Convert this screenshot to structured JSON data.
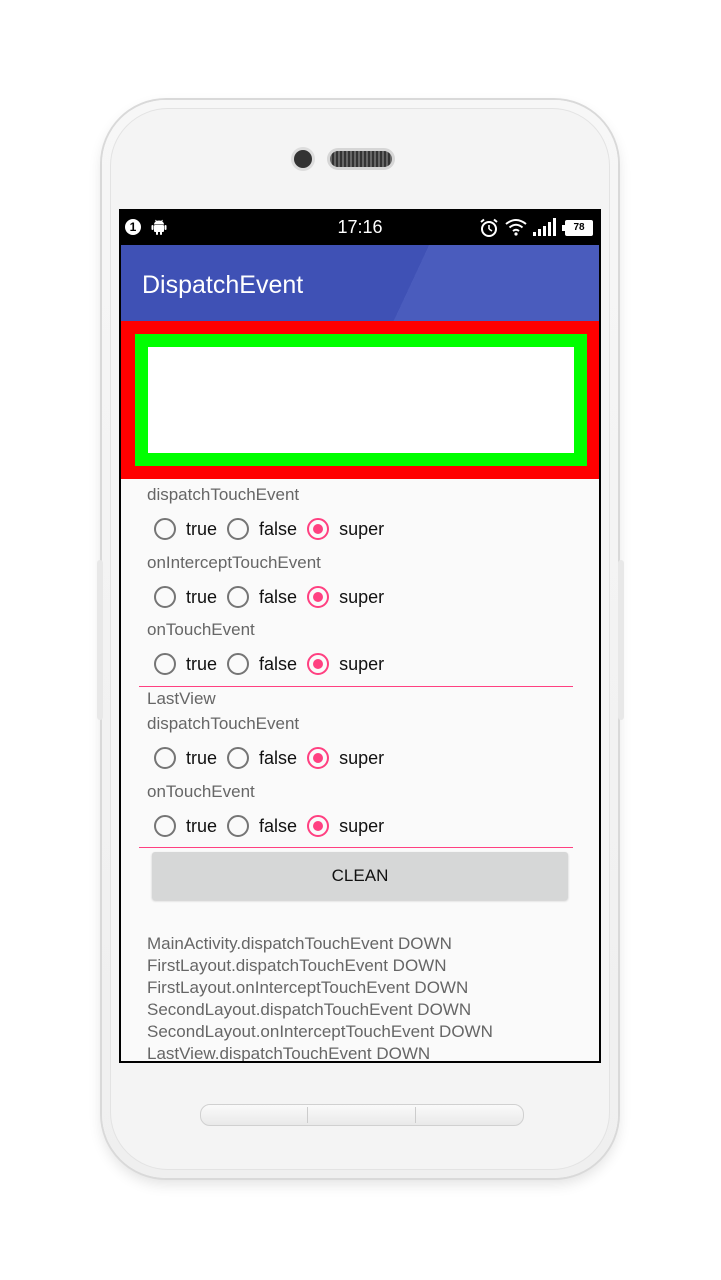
{
  "status_bar": {
    "notification_count": "1",
    "time": "17:16",
    "battery": "78"
  },
  "app_bar": {
    "title": "DispatchEvent"
  },
  "colors": {
    "outer_layout": "#ff0000",
    "inner_layout": "#00ff00",
    "last_view": "#ffffff",
    "primary": "#3f51b5",
    "accent": "#ff4081"
  },
  "sections": [
    {
      "label": "dispatchTouchEvent",
      "options": [
        "true",
        "false",
        "super"
      ],
      "selected": "super"
    },
    {
      "label": "onInterceptTouchEvent",
      "options": [
        "true",
        "false",
        "super"
      ],
      "selected": "super"
    },
    {
      "label": "onTouchEvent",
      "options": [
        "true",
        "false",
        "super"
      ],
      "selected": "super"
    }
  ],
  "last_view": {
    "header": "LastView",
    "sections": [
      {
        "label": "dispatchTouchEvent",
        "options": [
          "true",
          "false",
          "super"
        ],
        "selected": "super"
      },
      {
        "label": "onTouchEvent",
        "options": [
          "true",
          "false",
          "super"
        ],
        "selected": "super"
      }
    ]
  },
  "clean_button": "CLEAN",
  "log": [
    "MainActivity.dispatchTouchEvent DOWN",
    "FirstLayout.dispatchTouchEvent DOWN",
    "FirstLayout.onInterceptTouchEvent DOWN",
    "SecondLayout.dispatchTouchEvent DOWN",
    "SecondLayout.onInterceptTouchEvent DOWN",
    "LastView.dispatchTouchEvent DOWN"
  ]
}
